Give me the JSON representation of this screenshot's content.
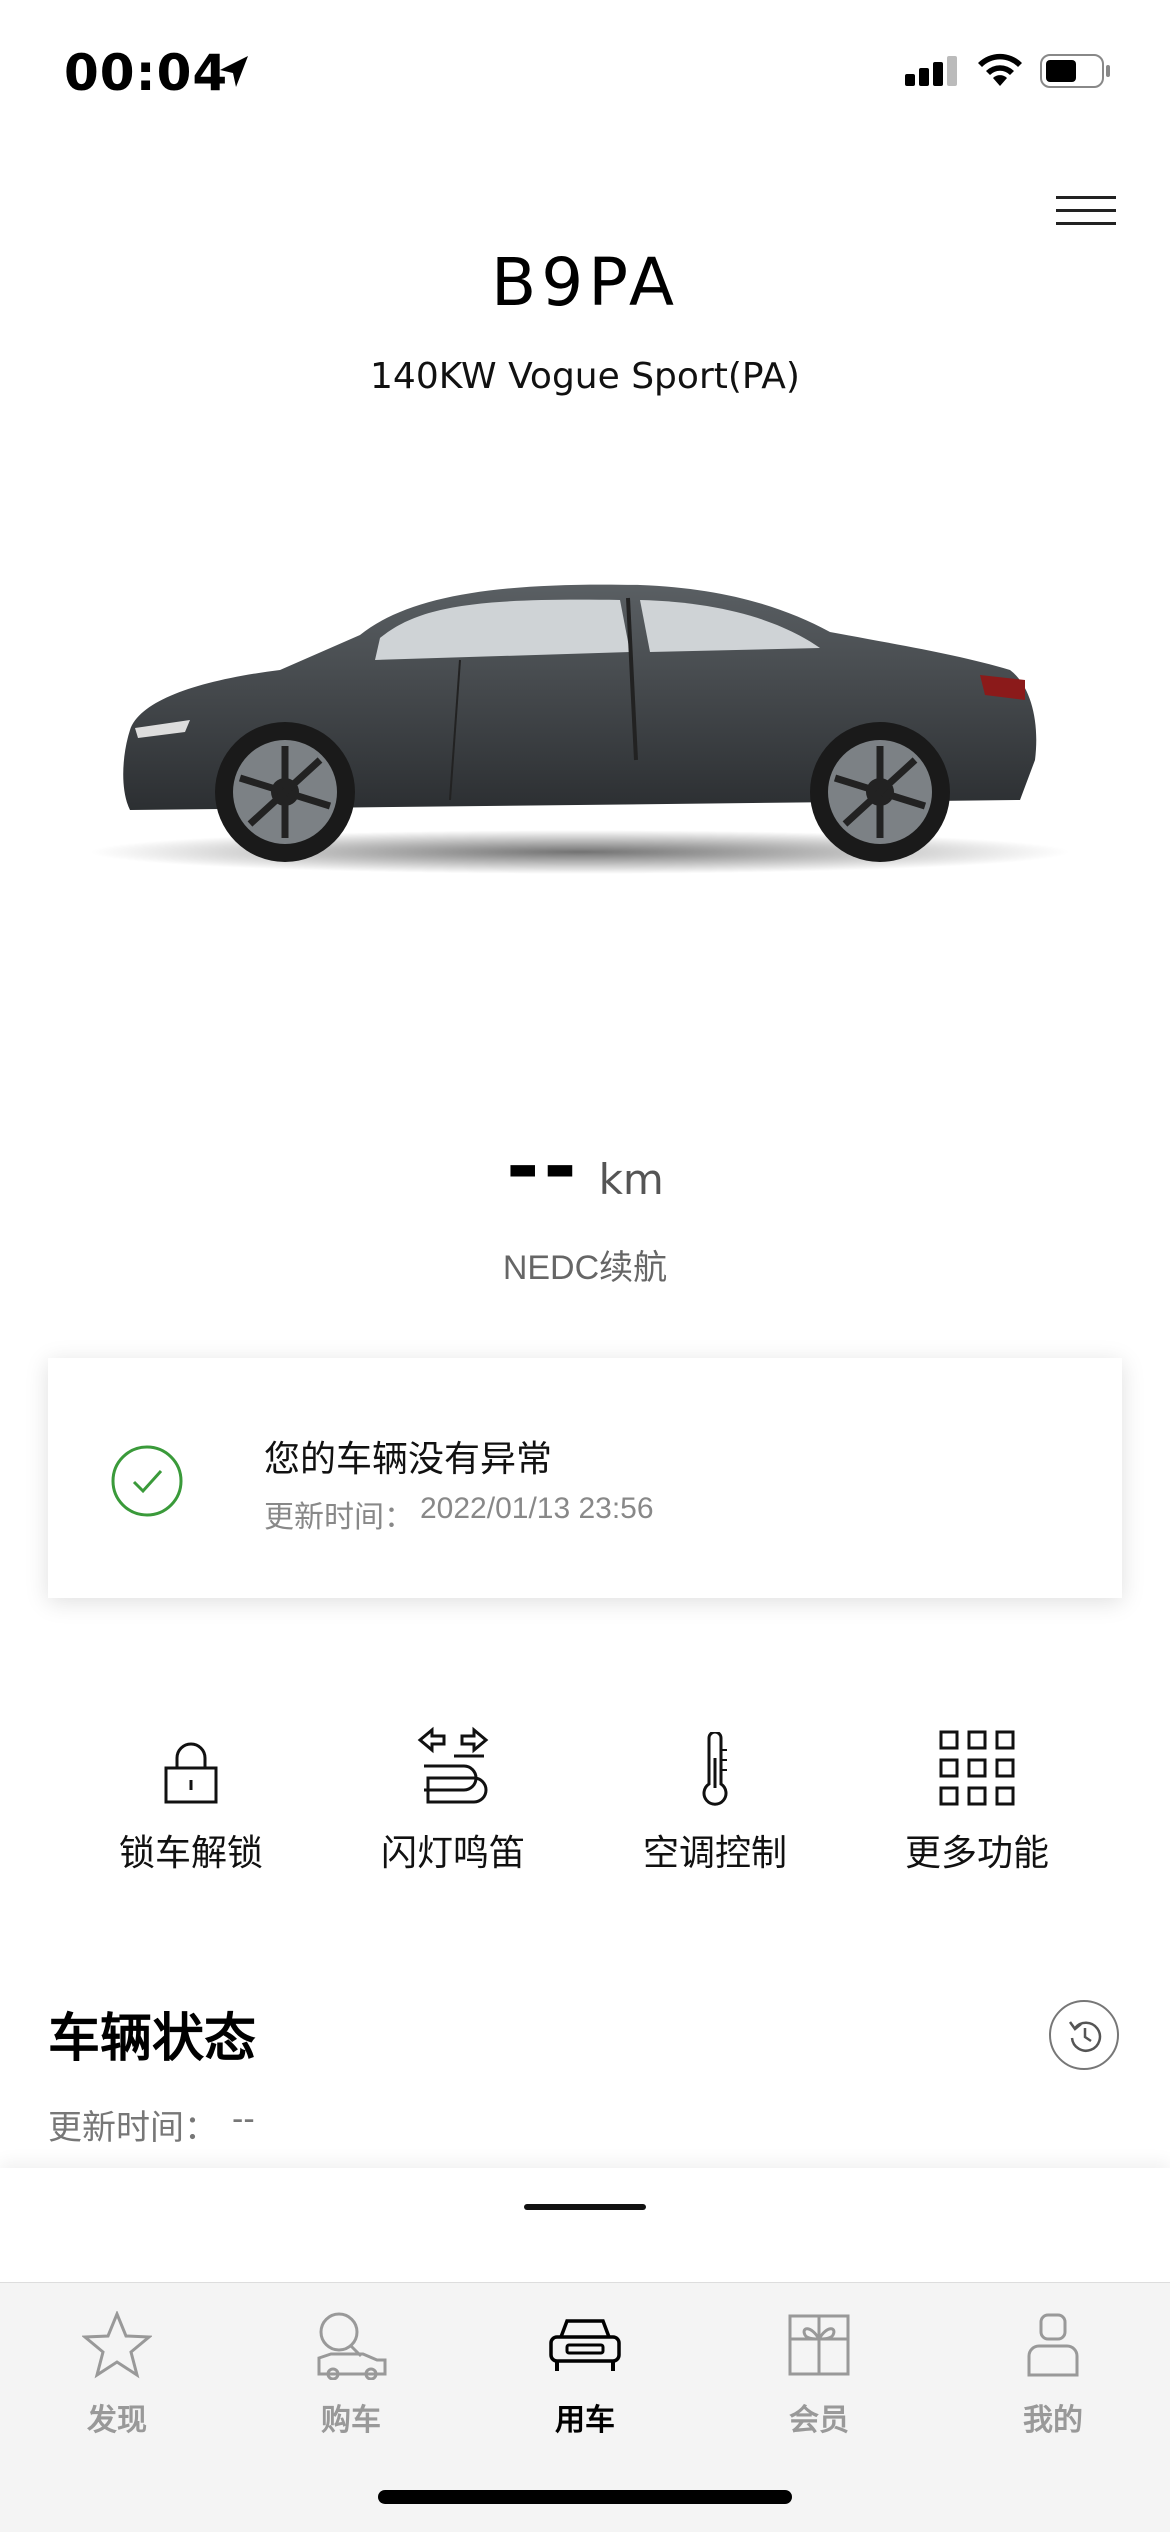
{
  "status_bar": {
    "time": "00:04"
  },
  "vehicle": {
    "name": "B9PA",
    "model": "140KW Vogue Sport(PA)",
    "car_color": "#3b3f43"
  },
  "range": {
    "value": "--",
    "unit": "km",
    "label": "NEDC续航"
  },
  "status_card": {
    "title": "您的车辆没有异常",
    "update_label": "更新时间：",
    "update_time": "2022/01/13 23:56",
    "accent_color": "#3a9a3a"
  },
  "actions": [
    {
      "label": "锁车解锁",
      "icon": "lock-icon"
    },
    {
      "label": "闪灯鸣笛",
      "icon": "flash-horn-icon"
    },
    {
      "label": "空调控制",
      "icon": "thermometer-icon"
    },
    {
      "label": "更多功能",
      "icon": "grid-icon"
    }
  ],
  "vehicle_status": {
    "title": "车辆状态",
    "update_label": "更新时间：",
    "update_time": "--"
  },
  "tabs": [
    {
      "label": "发现",
      "icon": "star-icon",
      "active": false
    },
    {
      "label": "购车",
      "icon": "car-search-icon",
      "active": false
    },
    {
      "label": "用车",
      "icon": "car-front-icon",
      "active": true
    },
    {
      "label": "会员",
      "icon": "gift-icon",
      "active": false
    },
    {
      "label": "我的",
      "icon": "user-icon",
      "active": false
    }
  ]
}
